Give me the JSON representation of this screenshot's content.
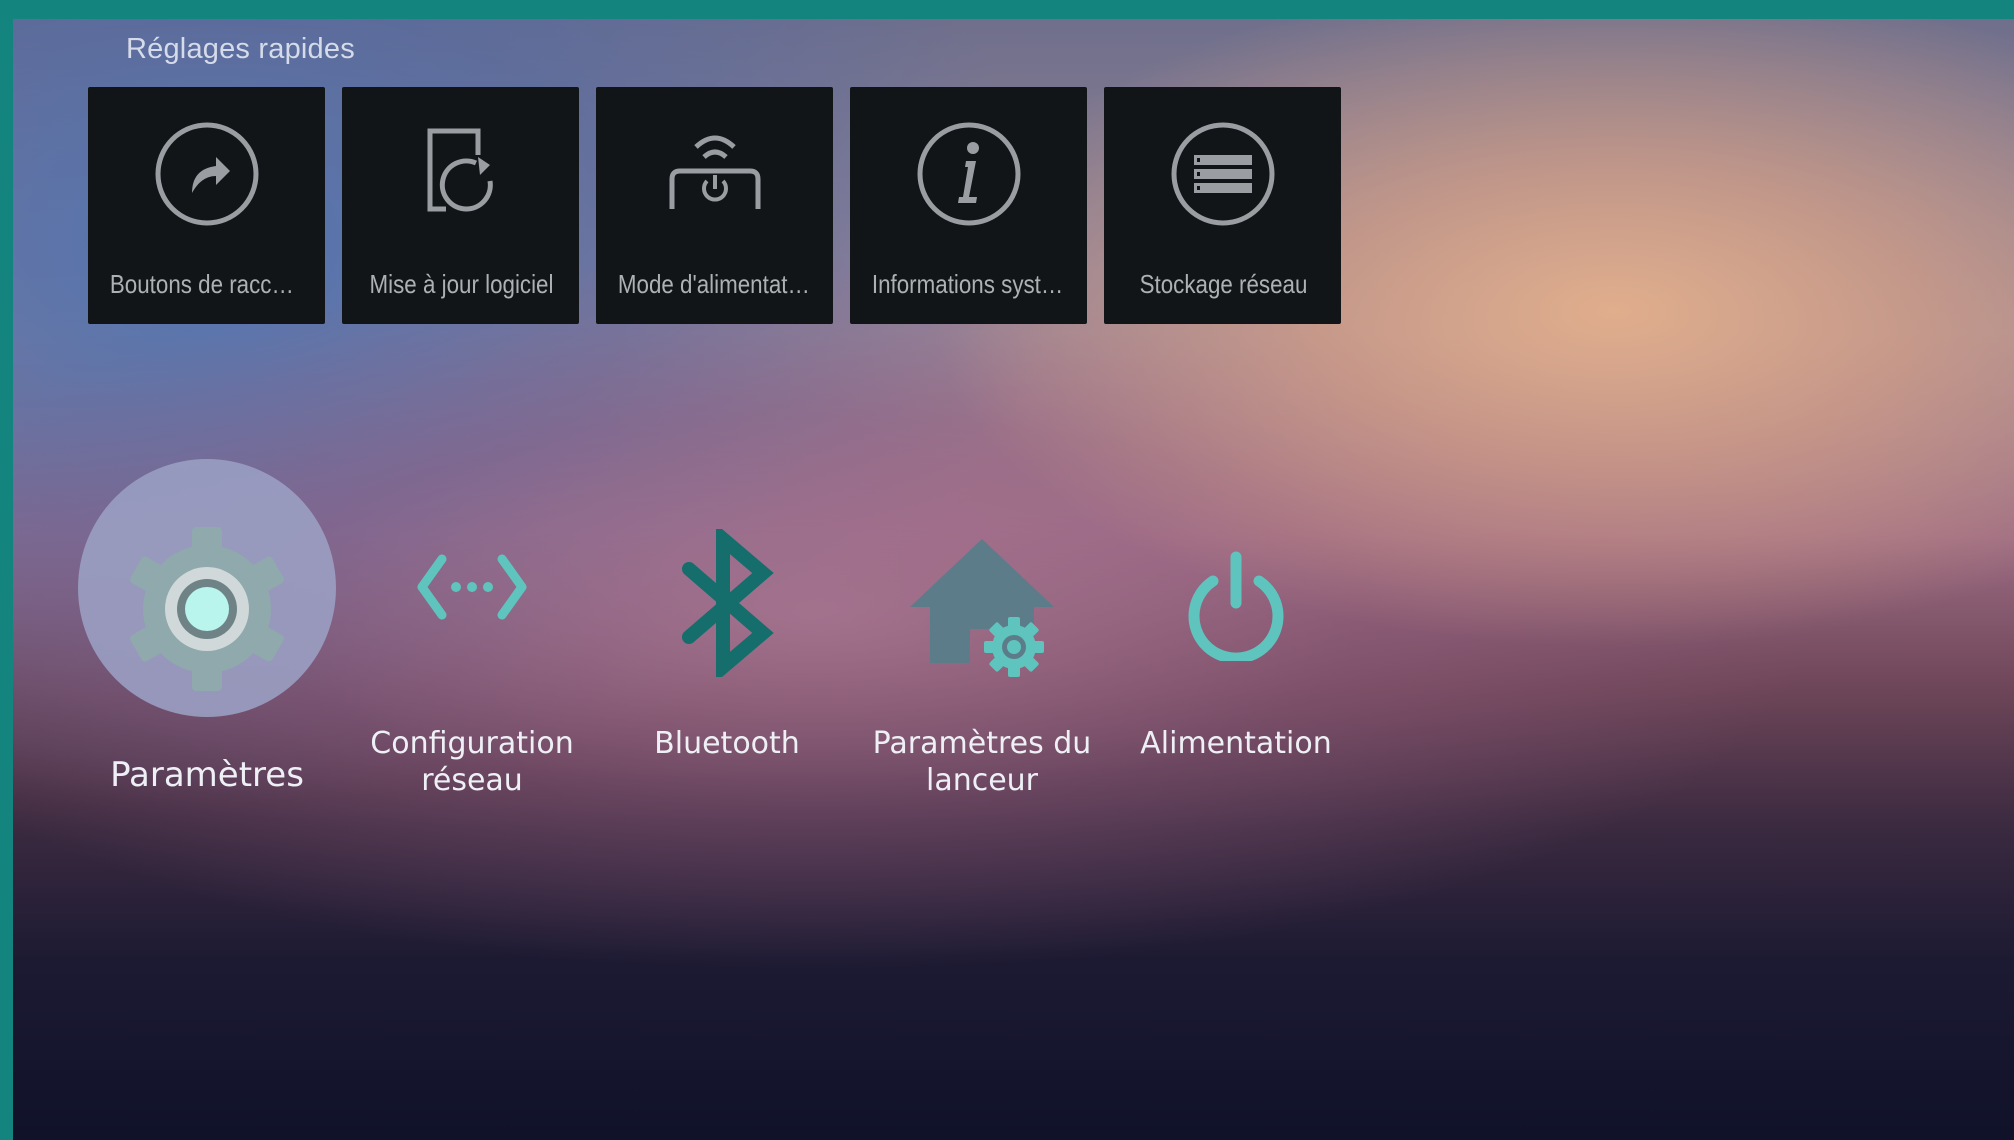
{
  "quick_settings": {
    "title": "Réglages rapides",
    "tiles": [
      {
        "label": "Boutons de raccou…",
        "icon": "shortcut-arrow-icon"
      },
      {
        "label": "Mise à jour logiciel",
        "icon": "software-update-icon"
      },
      {
        "label": "Mode d'alimentation",
        "icon": "power-mode-icon"
      },
      {
        "label": "Informations systè…",
        "icon": "info-icon"
      },
      {
        "label": "Stockage réseau",
        "icon": "network-storage-icon"
      }
    ]
  },
  "apps": {
    "items": [
      {
        "label": "Paramètres",
        "icon": "settings-gear-icon",
        "focused": true
      },
      {
        "label": "Configuration réseau",
        "icon": "network-config-icon"
      },
      {
        "label": "Bluetooth",
        "icon": "bluetooth-icon"
      },
      {
        "label": "Paramètres du lanceur",
        "icon": "launcher-settings-icon"
      },
      {
        "label": "Alimentation",
        "icon": "power-icon"
      }
    ]
  },
  "colors": {
    "accent_teal": "#5ec4bd",
    "dark_teal": "#156e6c",
    "house_slate": "#5c7c8a",
    "tile_bg": "#121517",
    "frame_border": "#14847e"
  }
}
